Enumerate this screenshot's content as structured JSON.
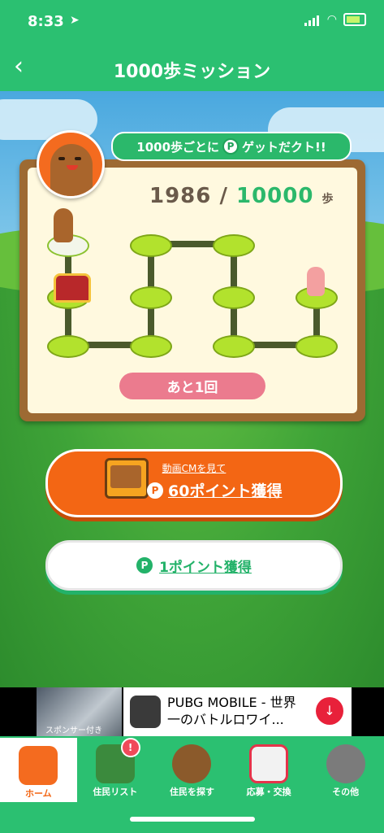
{
  "status": {
    "time": "8:33"
  },
  "header": {
    "title": "1000歩ミッション",
    "back_label": "‹"
  },
  "bubble": {
    "prefix": "1000歩ごとに",
    "suffix": "ゲットだクト!!"
  },
  "board": {
    "current_steps": "1986",
    "separator": "/",
    "goal_steps": "10000",
    "unit": "歩",
    "remaining_label": "あと1回"
  },
  "cm_button": {
    "small_label": "動画CMを見て",
    "main_label": "60ポイント獲得"
  },
  "free_button": {
    "label": "1ポイント獲得"
  },
  "coin_symbol": "P",
  "ad": {
    "sponsor_label": "スポンサー付き",
    "title": "PUBG MOBILE - 世界一のバトルロワイ..."
  },
  "tabs": [
    {
      "label": "ホーム",
      "active": true
    },
    {
      "label": "住民リスト",
      "badge": "!"
    },
    {
      "label": "住民を探す"
    },
    {
      "label": "応募・交換"
    },
    {
      "label": "その他"
    }
  ],
  "colors": {
    "accent": "#2bc071",
    "orange": "#f36614",
    "pink": "#eb7b8e"
  }
}
